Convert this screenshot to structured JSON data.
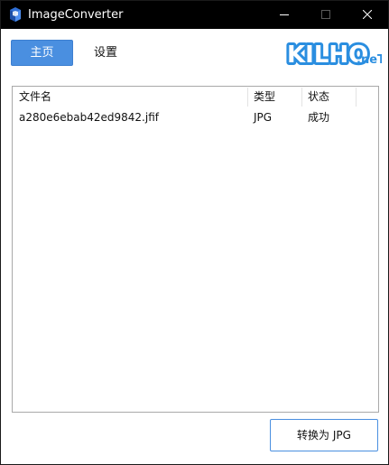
{
  "window": {
    "title": "ImageConverter",
    "controls": [
      "minimize",
      "maximize",
      "close"
    ]
  },
  "nav": {
    "home_label": "主页",
    "settings_label": "设置"
  },
  "brand": {
    "logo_text": "KILHO",
    "logo_suffix": ".neT",
    "logo_color": "#2a8ee0"
  },
  "list": {
    "columns": [
      "文件名",
      "类型",
      "状态"
    ],
    "rows": [
      {
        "filename": "a280e6ebab42ed9842.jfif",
        "type": "JPG",
        "status": "成功"
      }
    ]
  },
  "actions": {
    "convert_label": "转换为 JPG"
  },
  "colors": {
    "accent": "#4a8fe0",
    "titlebar": "#000000"
  }
}
